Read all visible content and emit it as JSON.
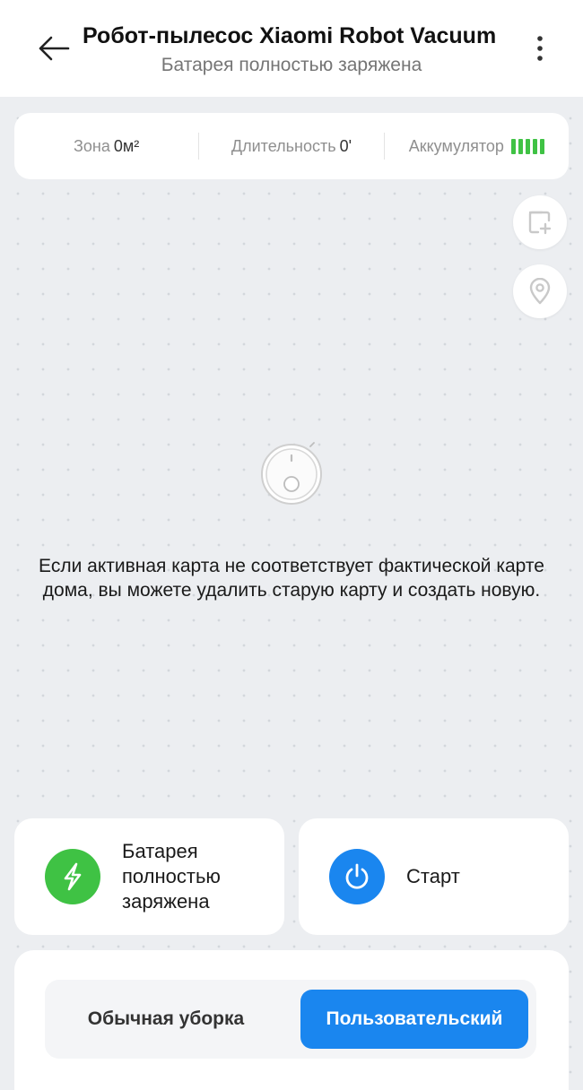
{
  "header": {
    "title": "Робот-пылесос Xiaomi Robot Vacuum",
    "subtitle": "Батарея полностью заряжена",
    "back_icon": "arrow-left-icon",
    "menu_icon": "more-vertical-icon"
  },
  "stats": {
    "area_label": "Зона",
    "area_value": "0м²",
    "duration_label": "Длительность",
    "duration_value": "0'",
    "battery_label": "Аккумулятор",
    "battery_bars": 5
  },
  "map": {
    "edit_icon": "map-edit-icon",
    "pin_icon": "location-pin-icon",
    "robot_icon": "robot-vacuum-icon",
    "notice": "Если активная карта не соответствует фактической карте дома, вы можете удалить старую карту и создать новую."
  },
  "actions": {
    "battery_label": "Батарея полностью заряжена",
    "battery_icon": "bolt-icon",
    "start_label": "Старт",
    "start_icon": "power-icon"
  },
  "modes": {
    "normal_label": "Обычная уборка",
    "custom_label": "Пользовательский",
    "selected": "custom"
  },
  "colors": {
    "accent_blue": "#1a86ef",
    "battery_green": "#3fc244",
    "background": "#eceef1"
  }
}
